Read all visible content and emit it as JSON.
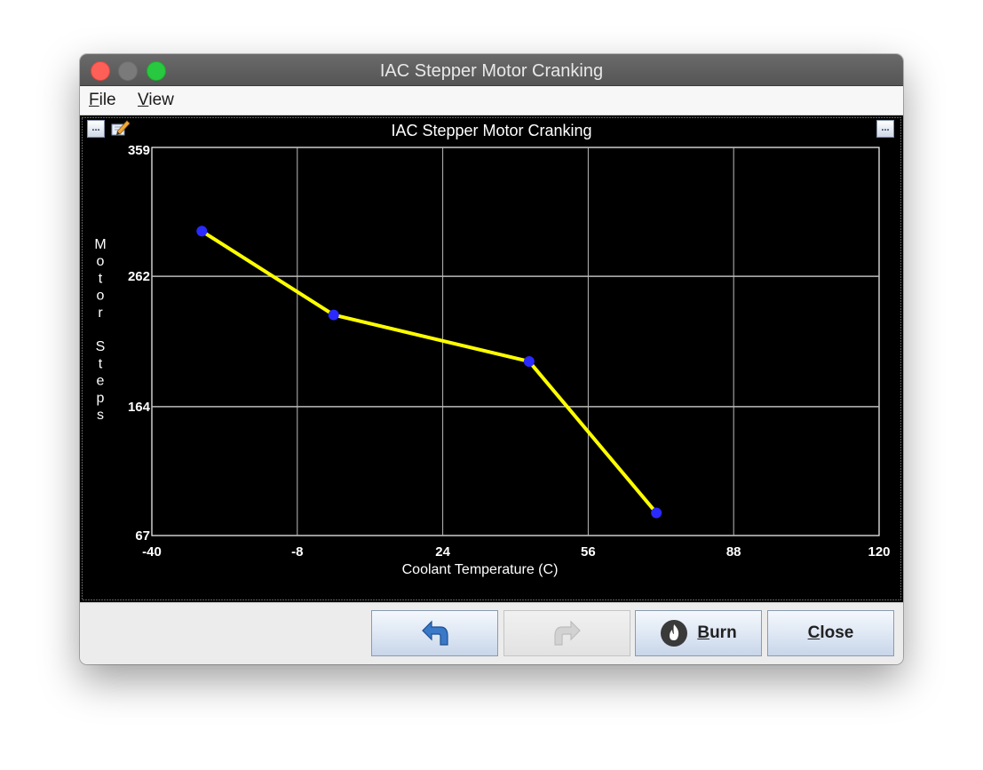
{
  "window": {
    "title": "IAC Stepper Motor Cranking"
  },
  "menu": {
    "file_label": "File",
    "view_label": "View"
  },
  "chart_panel": {
    "corner_left": "...",
    "corner_right": "..."
  },
  "buttons": {
    "undo_icon": "undo-arrow-icon",
    "redo_icon": "redo-arrow-icon",
    "burn_label": "Burn",
    "burn_icon": "flame-icon",
    "close_label": "Close"
  },
  "colors": {
    "line": "#ffff00",
    "point": "#2a2aff",
    "background": "#000000",
    "grid": "#ffffff"
  },
  "chart_data": {
    "type": "line",
    "title": "IAC Stepper Motor Cranking",
    "xlabel": "Coolant Temperature (C)",
    "ylabel": "Motor Steps",
    "x_ticks": [
      "-40",
      "-8",
      "24",
      "56",
      "88",
      "120"
    ],
    "y_ticks": [
      "359",
      "262",
      "164",
      "67"
    ],
    "xlim": [
      -40,
      120
    ],
    "ylim": [
      67,
      359
    ],
    "grid": true,
    "series": [
      {
        "x": [
          -29,
          0,
          43,
          71
        ],
        "y": [
          296,
          233,
          198,
          84
        ]
      }
    ]
  }
}
